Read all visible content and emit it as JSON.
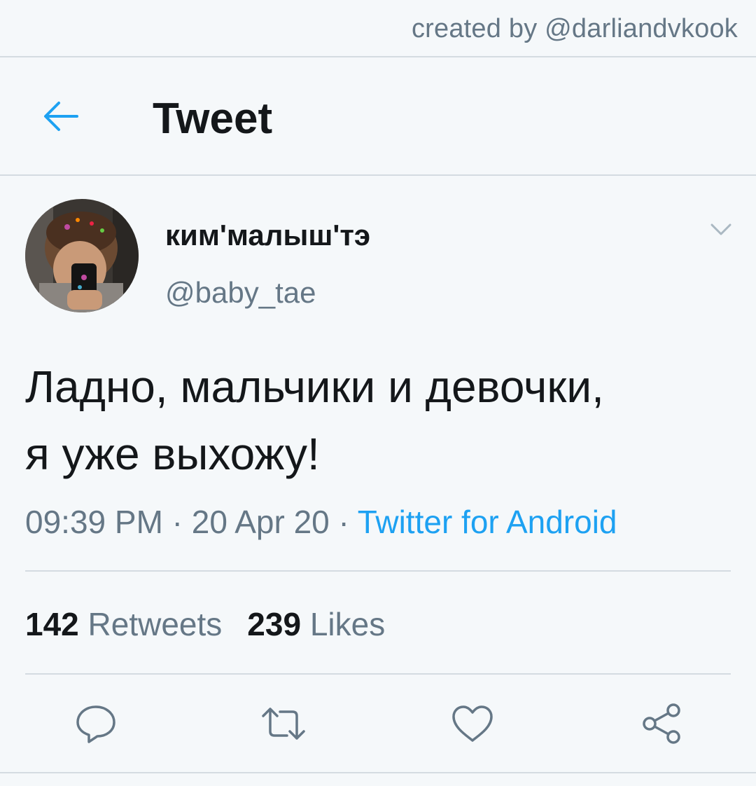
{
  "credit": "created by @darliandvkook",
  "header": {
    "title": "Tweet"
  },
  "tweet": {
    "author_name": "ким'малыш'тэ",
    "author_handle": "@baby_tae",
    "text_line1": "Ладно, мальчики и девочки,",
    "text_line2": "я уже выхожу!",
    "time": "09:39 PM",
    "date": "20 Apr 20",
    "separator": " · ",
    "source": "Twitter for Android",
    "retweets_count": "142",
    "retweets_label": "Retweets",
    "likes_count": "239",
    "likes_label": "Likes"
  },
  "colors": {
    "accent": "#1da1f2",
    "muted": "#657786",
    "text": "#14171a",
    "background": "#f5f8fa",
    "divider": "#d4dbe1"
  },
  "icons": [
    "back-arrow-icon",
    "chevron-down-icon",
    "reply-icon",
    "retweet-icon",
    "like-icon",
    "share-icon"
  ]
}
